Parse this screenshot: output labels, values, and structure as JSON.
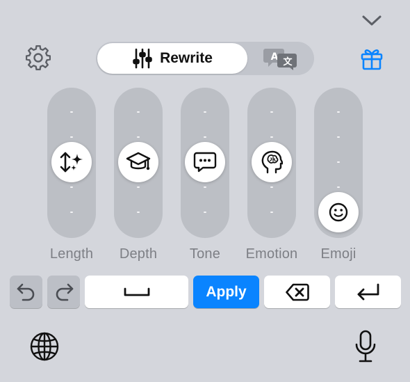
{
  "header": {
    "collapse_icon": "chevron-down-icon",
    "settings_icon": "gear-icon",
    "gift_icon": "gift-icon",
    "accent_color": "#0a84ff"
  },
  "mode_switch": {
    "rewrite_label": "Rewrite",
    "rewrite_icon": "sliders-icon",
    "translate_icon": "translate-icon",
    "selected": "Rewrite"
  },
  "sliders": [
    {
      "label": "Length",
      "icon": "length-sparkle-icon",
      "level_index": 2,
      "levels": 5
    },
    {
      "label": "Depth",
      "icon": "graduation-cap-icon",
      "level_index": 2,
      "levels": 5
    },
    {
      "label": "Tone",
      "icon": "chat-bubble-icon",
      "level_index": 2,
      "levels": 5
    },
    {
      "label": "Emotion",
      "icon": "brain-head-icon",
      "level_index": 2,
      "levels": 5
    },
    {
      "label": "Emoji",
      "icon": "smiley-icon",
      "level_index": 4,
      "levels": 5
    }
  ],
  "keys": {
    "undo_icon": "undo-icon",
    "redo_icon": "redo-icon",
    "space_icon": "space-bar-icon",
    "apply_label": "Apply",
    "delete_icon": "backspace-icon",
    "return_icon": "return-icon"
  },
  "footer": {
    "globe_icon": "globe-icon",
    "mic_icon": "microphone-icon"
  }
}
